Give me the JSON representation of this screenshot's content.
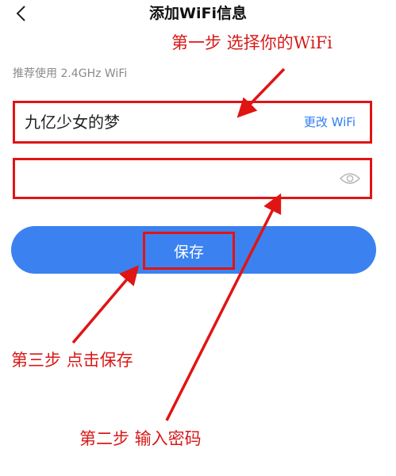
{
  "header": {
    "title": "添加WiFi信息"
  },
  "hint": "推荐使用 2.4GHz WiFi",
  "wifi": {
    "name": "九亿少女的梦",
    "change_label": "更改 WiFi"
  },
  "password": {
    "value": "",
    "placeholder": ""
  },
  "save_label": "保存",
  "annotations": {
    "step1": "第一步 选择你的WiFi",
    "step2": "第二步 输入密码",
    "step3": "第三步 点击保存"
  },
  "colors": {
    "accent": "#3b82f0",
    "annotation": "#e11414",
    "link": "#2f7ef5"
  },
  "icons": {
    "back": "chevron-left-icon",
    "eye": "eye-icon"
  }
}
